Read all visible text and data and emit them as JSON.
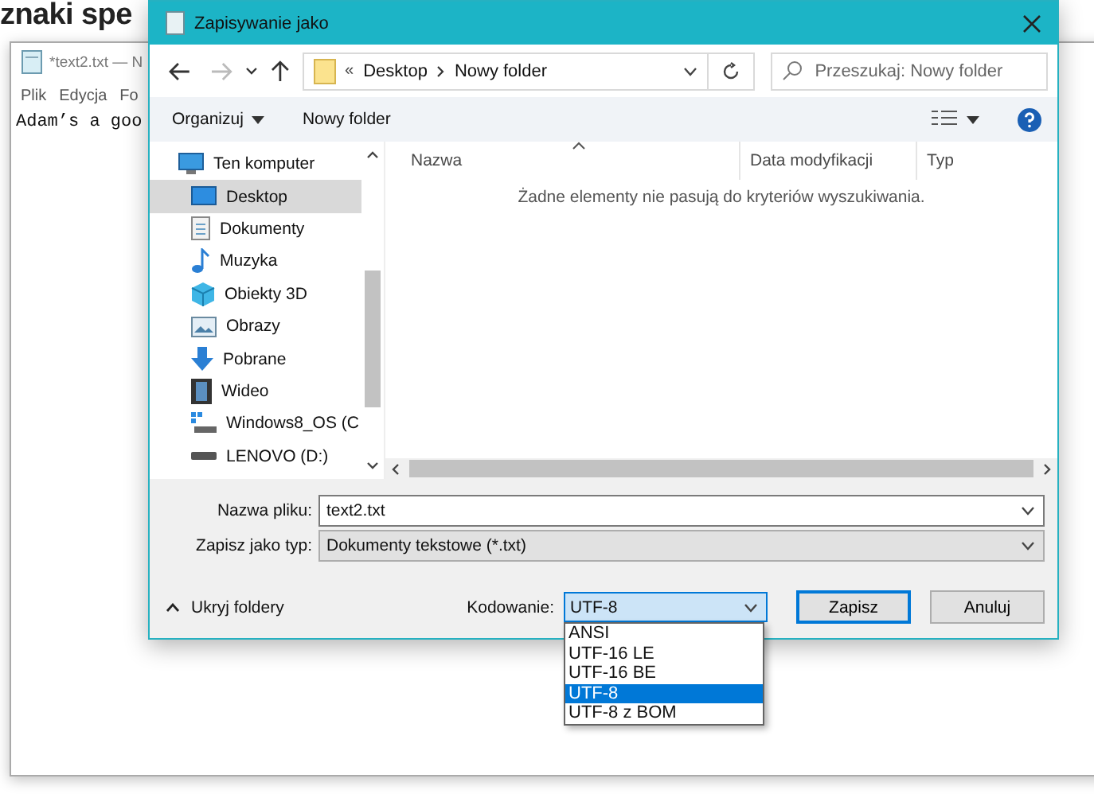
{
  "background_page": {
    "heading": "znaki spe"
  },
  "notepad": {
    "title": "*text2.txt — N",
    "menu": [
      "Plik",
      "Edycja",
      "Fo"
    ],
    "text": "Adam’s a goo"
  },
  "dialog": {
    "title": "Zapisywanie jako",
    "nav_buttons": [
      {
        "kind": "back",
        "disabled": false
      },
      {
        "kind": "forward",
        "disabled": true
      },
      {
        "kind": "recent",
        "disabled": false
      },
      {
        "kind": "up",
        "disabled": false
      }
    ],
    "address": {
      "prefix": "«",
      "segments": [
        "Desktop",
        "Nowy folder"
      ]
    },
    "search": {
      "placeholder": "Przeszukaj: Nowy folder"
    },
    "toolbar": [
      {
        "label": "Organizuj",
        "dropdown": true
      },
      {
        "label": "Nowy folder",
        "dropdown": false
      }
    ],
    "nav_tree": [
      {
        "label": "Ten komputer",
        "kind": "computer",
        "selected": false,
        "children": [
          {
            "label": "Desktop",
            "kind": "desktop",
            "selected": true
          },
          {
            "label": "Dokumenty",
            "kind": "documents",
            "selected": false
          },
          {
            "label": "Muzyka",
            "kind": "music",
            "selected": false
          },
          {
            "label": "Obiekty 3D",
            "kind": "objects3d",
            "selected": false
          },
          {
            "label": "Obrazy",
            "kind": "pictures",
            "selected": false
          },
          {
            "label": "Pobrane",
            "kind": "downloads",
            "selected": false
          },
          {
            "label": "Wideo",
            "kind": "videos",
            "selected": false
          },
          {
            "label": "Windows8_OS (C",
            "kind": "system-drive",
            "selected": false
          },
          {
            "label": "LENOVO (D:)",
            "kind": "drive",
            "selected": false
          }
        ]
      }
    ],
    "columns": [
      "Nazwa",
      "Data modyfikacji",
      "Typ"
    ],
    "empty_message": "Żadne elementy nie pasują do kryteriów wyszukiwania.",
    "filename": {
      "label": "Nazwa pliku:",
      "value": "text2.txt"
    },
    "filetype": {
      "label": "Zapisz jako typ:",
      "value": "Dokumenty tekstowe (*.txt)"
    },
    "hide_folders": "Ukryj foldery",
    "encoding": {
      "label": "Kodowanie:",
      "value": "UTF-8",
      "expanded": true,
      "options": [
        {
          "label": "ANSI",
          "selected": false
        },
        {
          "label": "UTF-16 LE",
          "selected": false
        },
        {
          "label": "UTF-16 BE",
          "selected": false
        },
        {
          "label": "UTF-8",
          "selected": true
        },
        {
          "label": "UTF-8 z BOM",
          "selected": false
        }
      ]
    },
    "buttons": [
      {
        "label": "Zapisz",
        "default": true
      },
      {
        "label": "Anuluj",
        "default": false
      }
    ]
  }
}
